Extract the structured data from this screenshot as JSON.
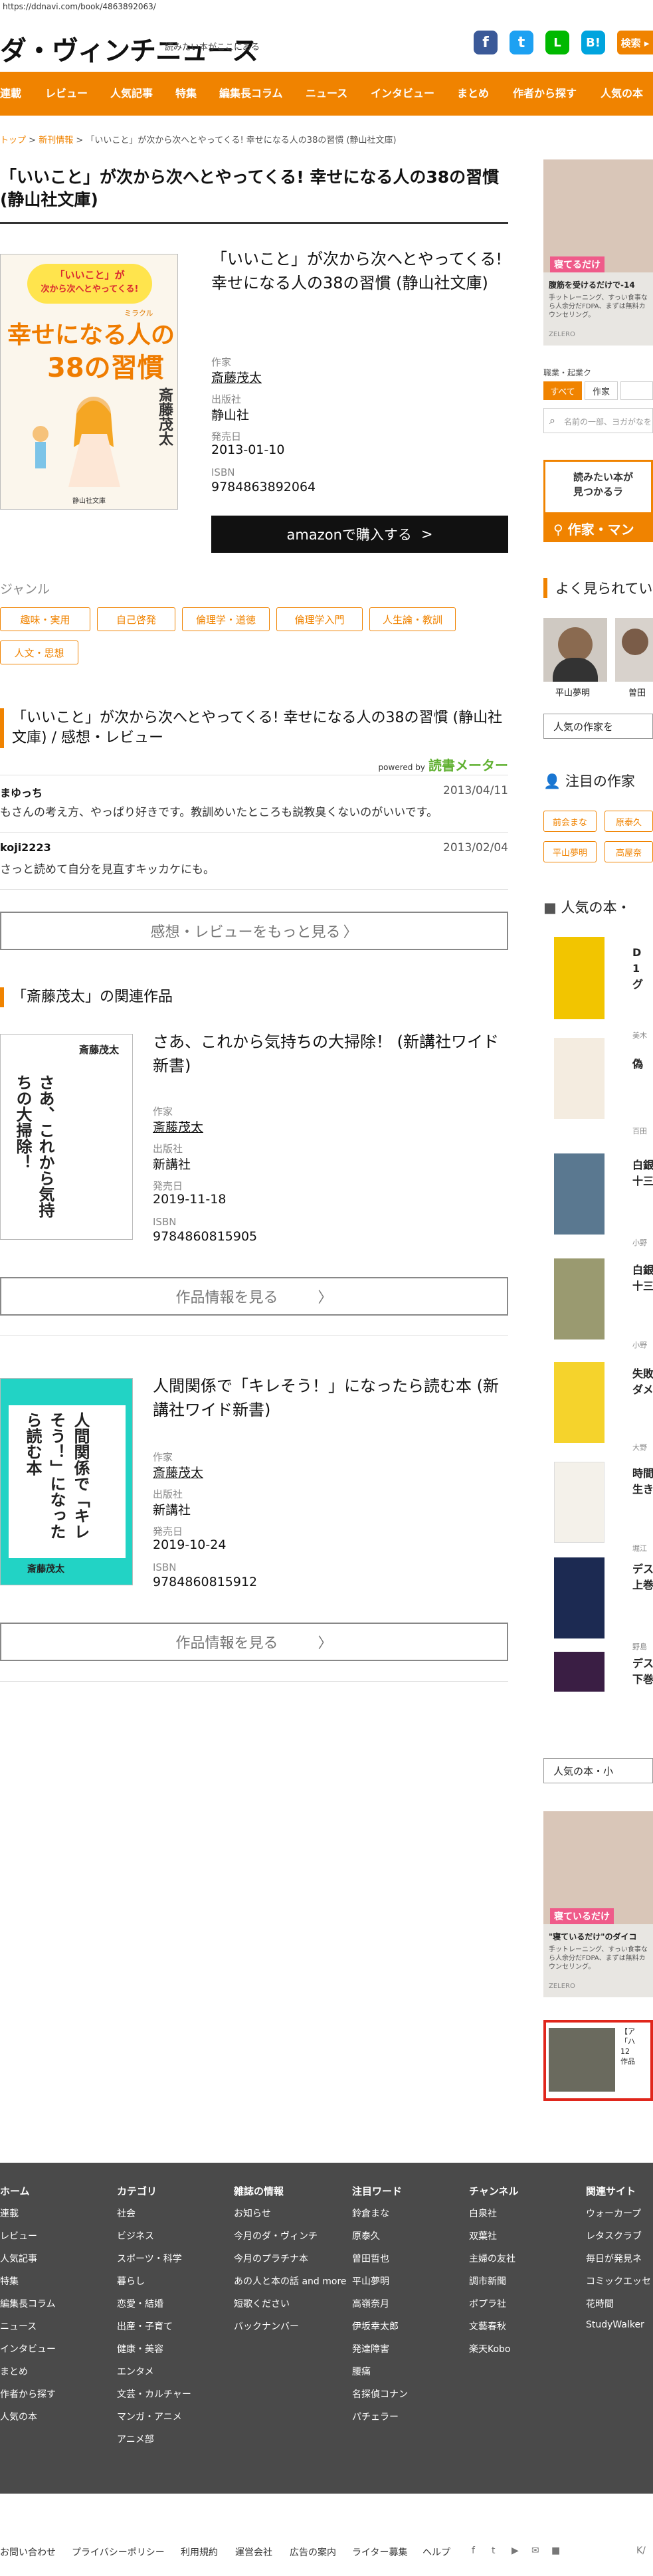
{
  "url": "https://ddnavi.com/book/4863892063/",
  "header": {
    "logo": "ダ・ヴィンチニュース",
    "tagline": "読みたい本がここにある",
    "social": [
      "f",
      "t",
      "L",
      "B!"
    ]
  },
  "nav": [
    "連載",
    "レビュー",
    "人気記事",
    "特集",
    "編集長コラム",
    "ニュース",
    "インタビュー",
    "まとめ",
    "作者から探す",
    "人気の本"
  ],
  "breadcrumb": {
    "top": "トップ",
    "sep": ">",
    "cat": "新刊情報",
    "current": "「いいこと」が次から次へとやってくる! 幸せになる人の38の習慣 (静山社文庫)"
  },
  "book": {
    "title": "「いいこと」が次から次へとやってくる! 幸せになる人の38の習慣 (静山社文庫)",
    "cover": {
      "line1": "「いいこと」が",
      "line2": "次から次へとやってくる!",
      "small": "ミラクル",
      "big1": "幸せになる人の",
      "big2": "38の習慣",
      "author": "斎藤茂太",
      "publisher": "静山社文庫"
    },
    "author_label": "作家",
    "author": "斎藤茂太",
    "publisher_label": "出版社",
    "publisher": "静山社",
    "date_label": "発売日",
    "date": "2013-01-10",
    "isbn_label": "ISBN",
    "isbn": "9784863892064",
    "amazon": "amazonで購入する"
  },
  "genre": {
    "heading": "ジャンル",
    "tags": [
      "趣味・実用",
      "自己啓発",
      "倫理学・道徳",
      "倫理学入門",
      "人生論・教訓",
      "人文・思想"
    ]
  },
  "reviews": {
    "heading": "「いいこと」が次から次へとやってくる! 幸せになる人の38の習慣 (静山社文庫) / 感想・レビュー",
    "powered": "powered by",
    "powered_brand": "読書メーター",
    "items": [
      {
        "name": "まゆっち",
        "date": "2013/04/11",
        "text": "もさんの考え方、やっぱり好きです。教訓めいたところも説教臭くないのがいいです。"
      },
      {
        "name": "koji2223",
        "date": "2013/02/04",
        "text": "さっと読めて自分を見直すキッカケにも。"
      }
    ],
    "more": "感想・レビューをもっと見る"
  },
  "related": {
    "heading": "「斎藤茂太」の関連作品",
    "items": [
      {
        "title": "さあ、これから気持ちの大掃除！ (新講社ワイド新書)",
        "author_label": "作家",
        "author": "斎藤茂太",
        "publisher_label": "出版社",
        "publisher": "新講社",
        "date_label": "発売日",
        "date": "2019-11-18",
        "isbn_label": "ISBN",
        "isbn": "9784860815905",
        "btn": "作品情報を見る",
        "cover_author": "斎藤茂太",
        "cover_title": "さあ、これから気持ちの大掃除！"
      },
      {
        "title": "人間関係で「キレそう！」になったら読む本 (新講社ワイド新書)",
        "author_label": "作家",
        "author": "斎藤茂太",
        "publisher_label": "出版社",
        "publisher": "新講社",
        "date_label": "発売日",
        "date": "2019-10-24",
        "isbn_label": "ISBN",
        "isbn": "9784860815912",
        "btn": "作品情報を見る",
        "cover_author": "斎藤茂太",
        "cover_title": "人間関係で「キレそう！」になったら読む本"
      }
    ]
  },
  "sidebar": {
    "ad1_head": "寝てるだけ",
    "ad1_line": "腹筋を受けるだけで-14",
    "ad1_sub": "手ットレーニング、すっい食事なら人余分だFDPA、まずは無料カウンセリング。",
    "ad1_tag": "ZELERO",
    "search_label": "職業・起業ク",
    "search_tabs": [
      "すべて",
      "作家"
    ],
    "search_placeholder": "名前の一部、ヨガがなを",
    "banner_top": "読みたい本が",
    "banner_top2": "見つかるラ",
    "banner_bottom": "作家・マン",
    "popular_heading": "よく見られてい",
    "popular_authors": [
      "平山夢明",
      "曽田"
    ],
    "popular_btn": "人気の作家を",
    "attention_heading": "注目の作家",
    "attention_tags": [
      "前会まな",
      "原泰久",
      "平山夢明",
      "高屋奈"
    ],
    "books_heading": "人気の本・",
    "books": [
      {
        "t": "D\n1\nグ",
        "a": "美木"
      },
      {
        "t": "偽",
        "a": ""
      },
      {
        "t": "白銀\n十三",
        "a": "百田"
      },
      {
        "t": "白銀\n十三",
        "a": "小野"
      },
      {
        "t": "失敗\nダメ",
        "a": "小野"
      },
      {
        "t": "時間\n生き",
        "a": "大野"
      },
      {
        "t": "デス\n上巻",
        "a": "堀江"
      },
      {
        "t": "デス\n下巻",
        "a": "野島"
      }
    ],
    "books_btn": "人気の本・小",
    "ad2_head": "寝ているだけ",
    "ad2_line": "\"寝ているだけ\"のダイコ",
    "ad2_sub": "手ットレーニング、すっい食事なら人余分だFDPA、まずは無料カウンセリング。",
    "ad2_tag": "ZELERO",
    "ad3_text": "【ア\n「ハ\n12\n作品"
  },
  "footer": {
    "cols": [
      {
        "head": "ホーム",
        "items": [
          "連載",
          "レビュー",
          "人気記事",
          "特集",
          "編集長コラム",
          "ニュース",
          "インタビュー",
          "まとめ",
          "作者から探す",
          "人気の本"
        ]
      },
      {
        "head": "カテゴリ",
        "items": [
          "社会",
          "ビジネス",
          "スポーツ・科学",
          "暮らし",
          "恋愛・結婚",
          "出産・子育て",
          "健康・美容",
          "エンタメ",
          "文芸・カルチャー",
          "マンガ・アニメ",
          "アニメ部"
        ]
      },
      {
        "head": "雑誌の情報",
        "items": [
          "お知らせ",
          "今月のダ・ヴィンチ",
          "今月のプラチナ本",
          "あの人と本の話 and more",
          "短歌ください",
          "バックナンバー"
        ]
      },
      {
        "head": "注目ワード",
        "items": [
          "鈴倉まな",
          "原泰久",
          "曽田哲也",
          "平山夢明",
          "高嶺奈月",
          "伊坂幸太郎",
          "発達障害",
          "腰痛",
          "名探偵コナン",
          "パチェラー"
        ]
      },
      {
        "head": "チャンネル",
        "items": [
          "白泉社",
          "双葉社",
          "主婦の友社",
          "調市新聞",
          "ポプラ社",
          "文藝春秋",
          "楽天Kobo"
        ]
      },
      {
        "head": "関連サイト",
        "items": [
          "ウォーカープ",
          "レタスクラブ",
          "毎日が発見ネ",
          "コミックエッセ",
          "花時間",
          "StudyWalker"
        ]
      }
    ]
  },
  "bottom": [
    "お問い合わせ",
    "プライバシーポリシー",
    "利用規約",
    "運営会社",
    "広告の案内",
    "ライター募集",
    "ヘルプ"
  ],
  "bottom_icons": [
    "f",
    "t",
    "▶",
    "✉",
    "■"
  ],
  "bottom_right": "K/",
  "colors": {
    "accent": "#f08300",
    "dark": "#333333",
    "footer": "#4a4a4a",
    "facebook": "#3b5998",
    "twitter": "#1da1f2",
    "line": "#00b900",
    "hatena": "#00a4de"
  }
}
